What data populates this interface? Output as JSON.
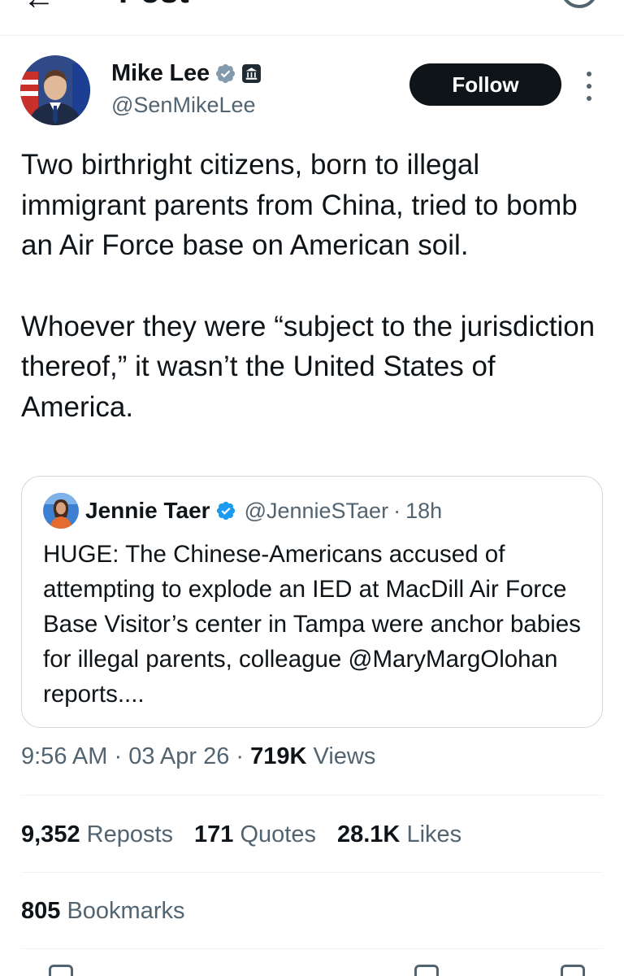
{
  "header": {
    "back_icon": "arrow-left-icon",
    "title": "Post"
  },
  "author": {
    "name": "Mike Lee",
    "handle": "@SenMikeLee",
    "verified_icon": "verified-badge-icon",
    "affiliation_icon": "government-building-icon",
    "follow_label": "Follow"
  },
  "tweet": {
    "paragraphs": [
      "Two birthright citizens, born to illegal immigrant parents from China, tried to bomb an Air Force base on American soil.",
      "Whoever they were “subject to the jurisdiction thereof,” it wasn’t the United States of America."
    ]
  },
  "quote": {
    "name": "Jennie Taer",
    "handle": "@JennieSTaer",
    "separator": "·",
    "time": "18h",
    "text": "HUGE: The Chinese-Americans accused of attempting to explode an IED at MacDill Air Force Base Visitor’s center in Tampa were anchor babies for illegal parents, colleague @MaryMargOlohan reports...."
  },
  "meta": {
    "time": "9:56 AM",
    "sep1": " · ",
    "date": "03 Apr 26",
    "sep2": " · ",
    "views_count": "719K",
    "views_label": " Views"
  },
  "stats": [
    {
      "count": "9,352",
      "label": "Reposts"
    },
    {
      "count": "171",
      "label": "Quotes"
    },
    {
      "count": "28.1K",
      "label": "Likes"
    }
  ],
  "bookmarks": {
    "count": "805",
    "label": "Bookmarks"
  },
  "colors": {
    "text": "#0f1419",
    "secondary": "#536471",
    "verified_blue": "#1d9bf0",
    "border": "#cfd9de",
    "divider": "#eff3f4"
  }
}
